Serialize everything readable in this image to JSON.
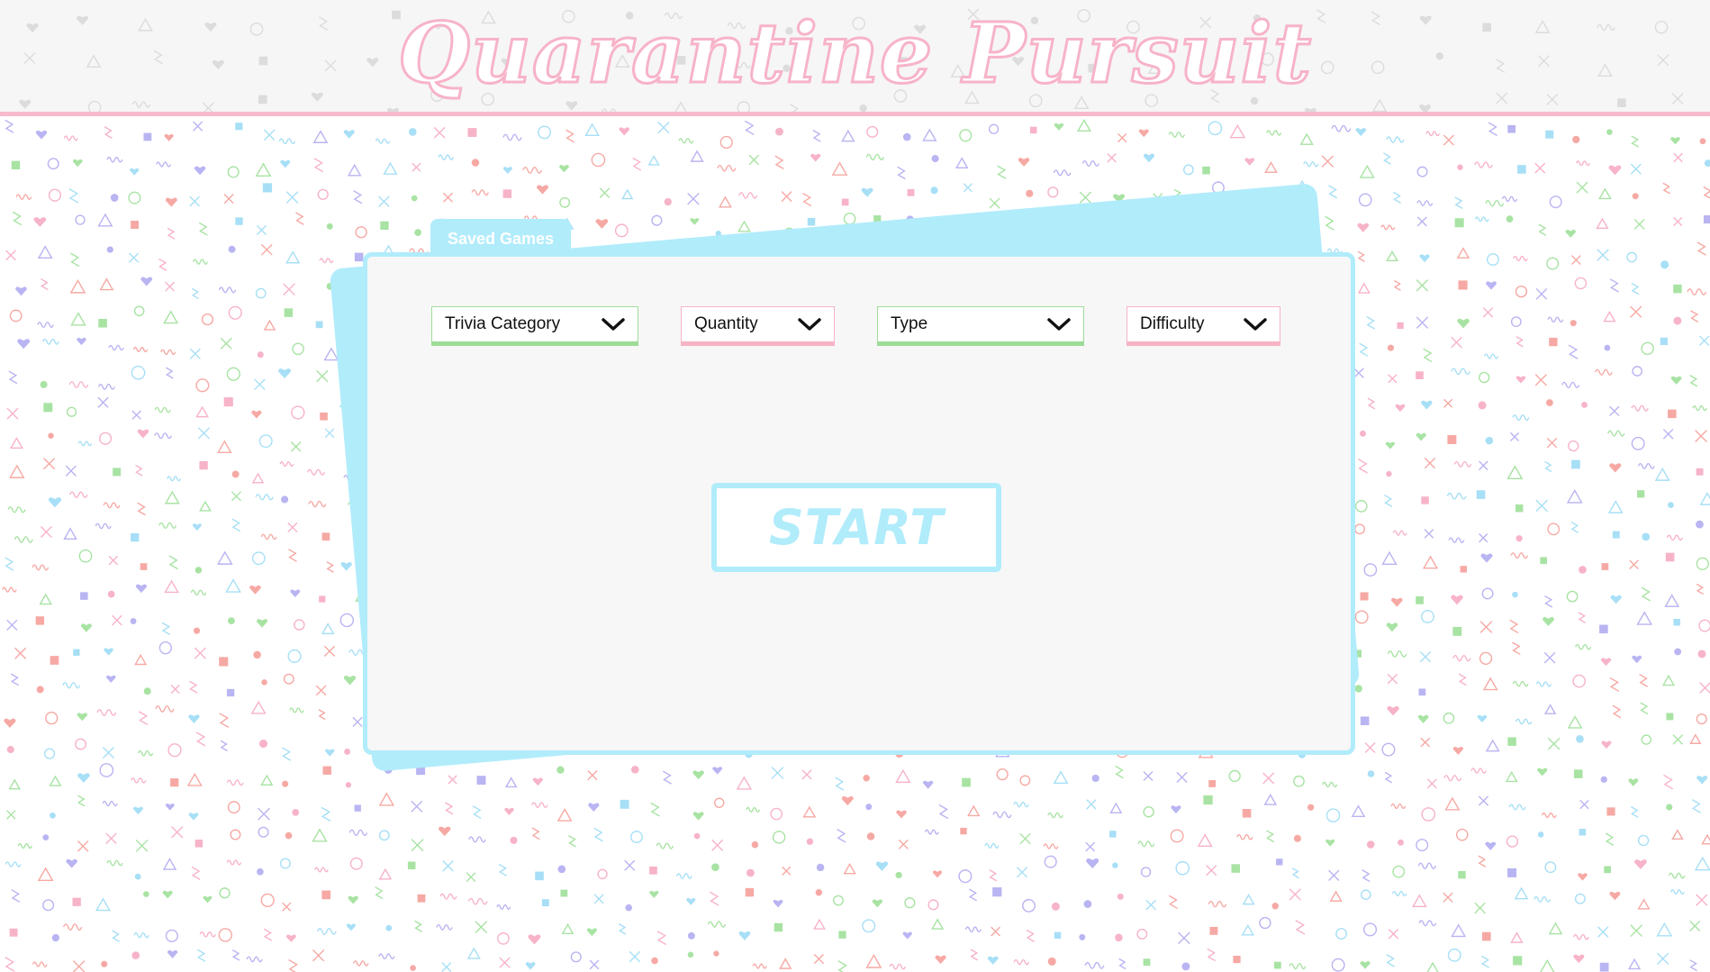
{
  "app": {
    "title": "Quarantine Pursuit"
  },
  "tabs": {
    "saved_games": "Saved Games"
  },
  "filters": [
    {
      "label": "Trivia Category",
      "icon": "chevron-down-icon",
      "accent": "#9ddc97"
    },
    {
      "label": "Quantity",
      "icon": "chevron-down-icon",
      "accent": "#f6b3c6"
    },
    {
      "label": "Type",
      "icon": "chevron-down-icon",
      "accent": "#9ddc97"
    },
    {
      "label": "Difficulty",
      "icon": "chevron-down-icon",
      "accent": "#f6b3c6"
    }
  ],
  "actions": {
    "start_label": "START"
  },
  "colors": {
    "accent_blue": "#b1ecfb",
    "accent_pink": "#f7b3c8",
    "accent_green": "#9ddc97",
    "panel_bg": "#f7f7f7",
    "header_bg": "#f6f6f6"
  }
}
